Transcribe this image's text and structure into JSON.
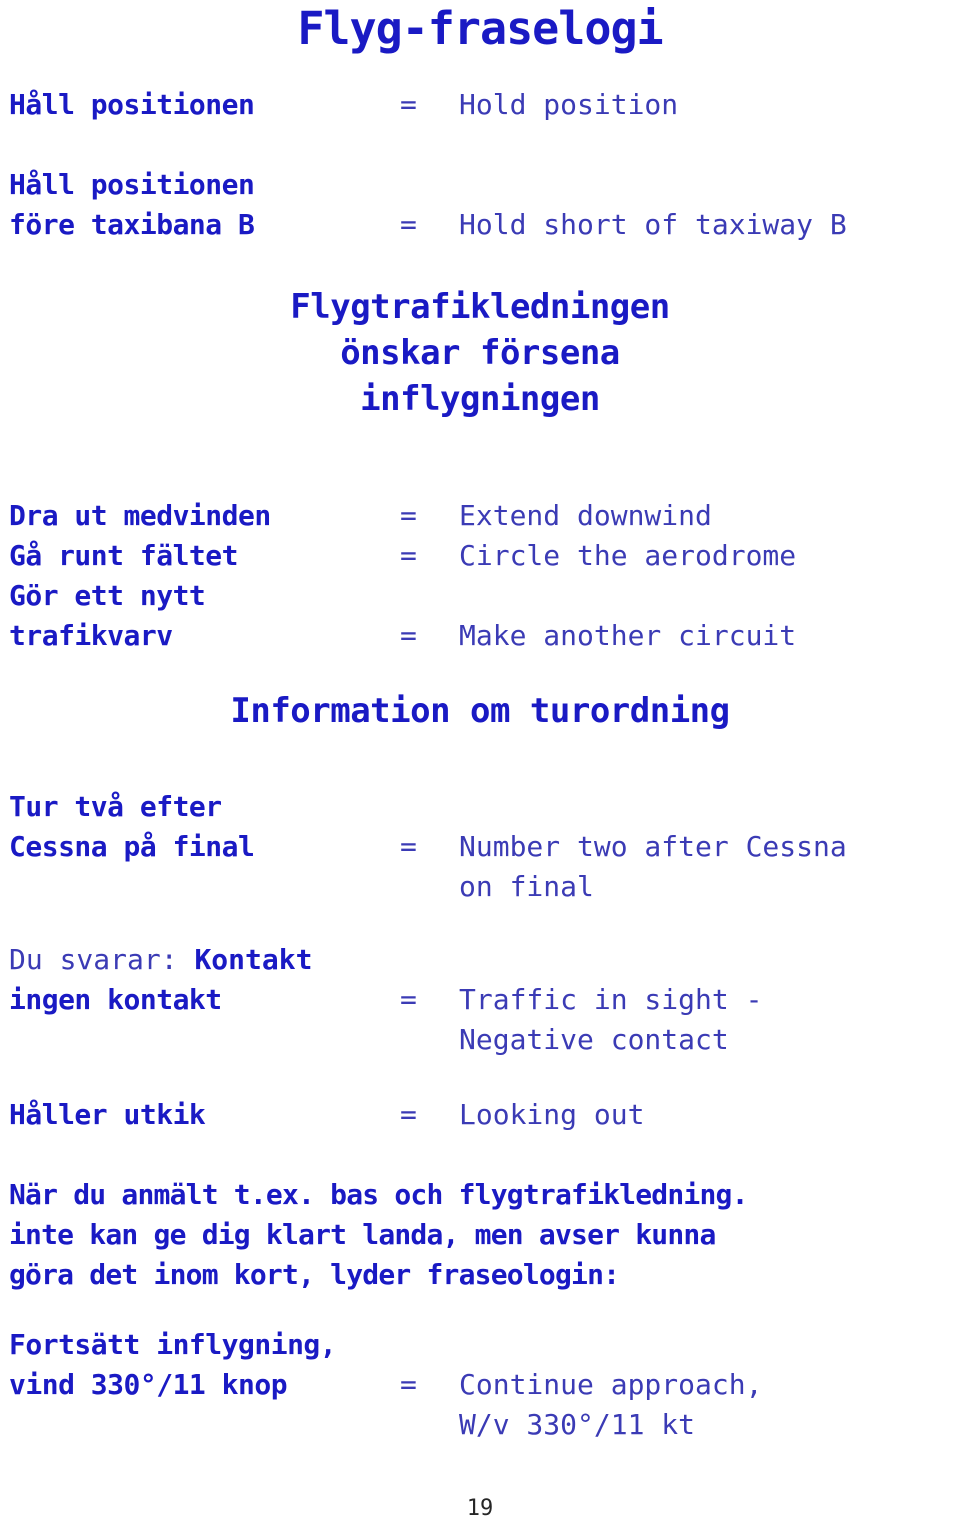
{
  "document": {
    "title": "Flyg-fraselogi",
    "page_number": "19",
    "colors": {
      "swedish_text": "#1a1ac4",
      "english_text": "#3b3bb5",
      "page_number": "#262626",
      "background": "#ffffff"
    }
  },
  "equals_sign": "=",
  "entries": {
    "hold_position": {
      "swedish": "Håll positionen",
      "english": "Hold position"
    },
    "hold_short": {
      "swedish_line1": "Håll positionen",
      "swedish_line2": "före taxibana B",
      "english": "Hold short of taxiway B"
    },
    "extend_downwind": {
      "swedish": "Dra ut medvinden",
      "english": "Extend downwind"
    },
    "circle_aerodrome": {
      "swedish": "Gå runt fältet",
      "english": "Circle the aerodrome"
    },
    "another_circuit": {
      "swedish_line1": "Gör ett nytt",
      "swedish_line2": "trafikvarv",
      "english": "Make another circuit"
    },
    "number_two": {
      "swedish_line1": "Tur två efter",
      "swedish_line2": "Cessna på final",
      "english_line1": "Number two after Cessna",
      "english_line2": "on final"
    },
    "negative_contact": {
      "swedish_lead": "Du svarar: ",
      "swedish_strong": "Kontakt",
      "swedish_line2": "ingen kontakt",
      "english_line1": "Traffic in sight -",
      "english_line2": "Negative contact"
    },
    "looking_out": {
      "swedish": "Håller utkik",
      "english": "Looking out"
    },
    "continue_approach": {
      "swedish_line1": "Fortsätt inflygning,",
      "swedish_line2": "vind 330°/11 knop",
      "english_line1": "Continue approach,",
      "english_line2": "W/v 330°/11 kt"
    }
  },
  "headings": {
    "atc_delay": {
      "line1": "Flygtrafikledningen",
      "line2": "önskar försena",
      "line3": "inflygningen"
    },
    "sequence_info": "Information om turordning"
  },
  "paragraph": {
    "line1": "När du anmält t.ex. bas och flygtrafikledning.",
    "line2": "inte kan ge dig klart landa, men avser kunna",
    "line3": "göra det inom kort, lyder fraseologin:"
  }
}
